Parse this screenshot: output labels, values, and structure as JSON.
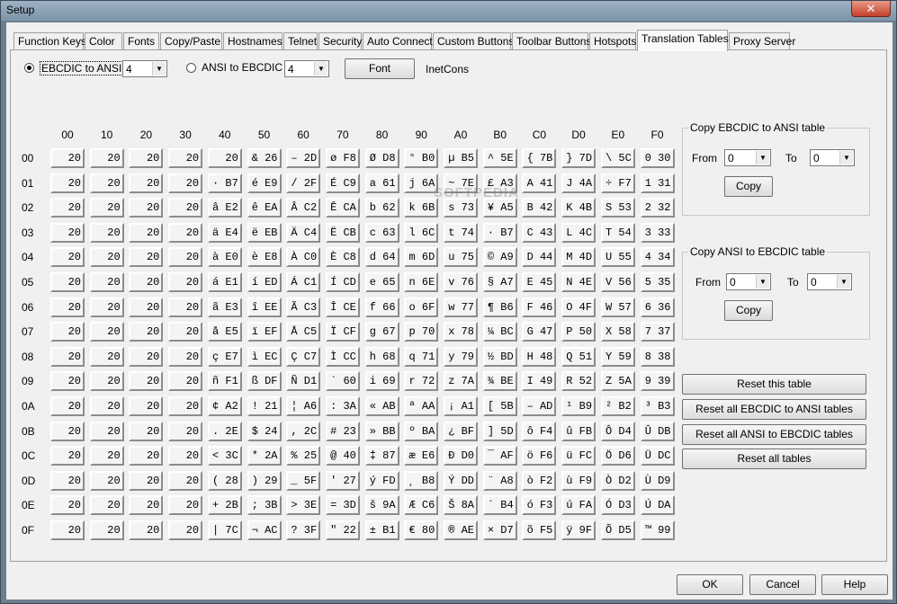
{
  "window": {
    "title": "Setup",
    "close_glyph": "✕"
  },
  "tabs": [
    "Function Keys",
    "Color",
    "Fonts",
    "Copy/Paste",
    "Hostnames",
    "Telnet",
    "Security",
    "Auto Connect",
    "Custom Buttons",
    "Toolbar Buttons",
    "Hotspots",
    "Translation Tables",
    "Proxy Server"
  ],
  "active_tab": "Translation Tables",
  "direction": {
    "ebcdic_label": "EBCDIC to ANSI",
    "ebcdic_value": "4",
    "ebcdic_selected": true,
    "ansi_label": "ANSI to EBCDIC",
    "ansi_value": "4",
    "font_button": "Font",
    "font_name": "InetCons"
  },
  "columns": [
    "00",
    "10",
    "20",
    "30",
    "40",
    "50",
    "60",
    "70",
    "80",
    "90",
    "A0",
    "B0",
    "C0",
    "D0",
    "E0",
    "F0"
  ],
  "rows": [
    "00",
    "01",
    "02",
    "03",
    "04",
    "05",
    "06",
    "07",
    "08",
    "09",
    "0A",
    "0B",
    "0C",
    "0D",
    "0E",
    "0F"
  ],
  "table": [
    [
      "20",
      "20",
      "20",
      "20",
      "20",
      "& 26",
      "– 2D",
      "ø F8",
      "Ø D8",
      "° B0",
      "µ B5",
      "^ 5E",
      "{ 7B",
      "} 7D",
      "\\ 5C",
      "0 30"
    ],
    [
      "20",
      "20",
      "20",
      "20",
      "· B7",
      "é E9",
      "/ 2F",
      "É C9",
      "a 61",
      "j 6A",
      "~ 7E",
      "£ A3",
      "A 41",
      "J 4A",
      "÷ F7",
      "1 31"
    ],
    [
      "20",
      "20",
      "20",
      "20",
      "â E2",
      "ê EA",
      "Â C2",
      "Ê CA",
      "b 62",
      "k 6B",
      "s 73",
      "¥ A5",
      "B 42",
      "K 4B",
      "S 53",
      "2 32"
    ],
    [
      "20",
      "20",
      "20",
      "20",
      "ä E4",
      "ë EB",
      "Ä C4",
      "Ë CB",
      "c 63",
      "l 6C",
      "t 74",
      "· B7",
      "C 43",
      "L 4C",
      "T 54",
      "3 33"
    ],
    [
      "20",
      "20",
      "20",
      "20",
      "à E0",
      "è E8",
      "À C0",
      "È C8",
      "d 64",
      "m 6D",
      "u 75",
      "© A9",
      "D 44",
      "M 4D",
      "U 55",
      "4 34"
    ],
    [
      "20",
      "20",
      "20",
      "20",
      "á E1",
      "í ED",
      "Á C1",
      "Í CD",
      "e 65",
      "n 6E",
      "v 76",
      "§ A7",
      "E 45",
      "N 4E",
      "V 56",
      "5 35"
    ],
    [
      "20",
      "20",
      "20",
      "20",
      "ã E3",
      "î EE",
      "Ã C3",
      "Î CE",
      "f 66",
      "o 6F",
      "w 77",
      "¶ B6",
      "F 46",
      "O 4F",
      "W 57",
      "6 36"
    ],
    [
      "20",
      "20",
      "20",
      "20",
      "å E5",
      "ï EF",
      "Å C5",
      "Ï CF",
      "g 67",
      "p 70",
      "x 78",
      "¼ BC",
      "G 47",
      "P 50",
      "X 58",
      "7 37"
    ],
    [
      "20",
      "20",
      "20",
      "20",
      "ç E7",
      "ì EC",
      "Ç C7",
      "Ì CC",
      "h 68",
      "q 71",
      "y 79",
      "½ BD",
      "H 48",
      "Q 51",
      "Y 59",
      "8 38"
    ],
    [
      "20",
      "20",
      "20",
      "20",
      "ñ F1",
      "ß DF",
      "Ñ D1",
      "` 60",
      "i 69",
      "r 72",
      "z 7A",
      "¾ BE",
      "I 49",
      "R 52",
      "Z 5A",
      "9 39"
    ],
    [
      "20",
      "20",
      "20",
      "20",
      "¢ A2",
      "! 21",
      "¦ A6",
      ": 3A",
      "« AB",
      "ª AA",
      "¡ A1",
      "[ 5B",
      "– AD",
      "¹ B9",
      "² B2",
      "³ B3"
    ],
    [
      "20",
      "20",
      "20",
      "20",
      ". 2E",
      "$ 24",
      ", 2C",
      "# 23",
      "» BB",
      "º BA",
      "¿ BF",
      "] 5D",
      "ô F4",
      "û FB",
      "Ô D4",
      "Û DB"
    ],
    [
      "20",
      "20",
      "20",
      "20",
      "< 3C",
      "* 2A",
      "% 25",
      "@ 40",
      "‡ 87",
      "æ E6",
      "Ð D0",
      "¯ AF",
      "ö F6",
      "ü FC",
      "Ö D6",
      "Ü DC"
    ],
    [
      "20",
      "20",
      "20",
      "20",
      "( 28",
      ") 29",
      "_ 5F",
      "' 27",
      "ý FD",
      "¸ B8",
      "Ý DD",
      "¨ A8",
      "ò F2",
      "ù F9",
      "Ò D2",
      "Ù D9"
    ],
    [
      "20",
      "20",
      "20",
      "20",
      "+ 2B",
      "; 3B",
      "> 3E",
      "= 3D",
      "š 9A",
      "Æ C6",
      "Š 8A",
      "´ B4",
      "ó F3",
      "ú FA",
      "Ó D3",
      "Ú DA"
    ],
    [
      "20",
      "20",
      "20",
      "20",
      "| 7C",
      "¬ AC",
      "? 3F",
      "\" 22",
      "± B1",
      "€ 80",
      "® AE",
      "× D7",
      "õ F5",
      "ÿ 9F",
      "Õ D5",
      "™ 99"
    ]
  ],
  "copy_e2a": {
    "title": "Copy EBCDIC to ANSI table",
    "from_label": "From",
    "from_value": "0",
    "to_label": "To",
    "to_value": "0",
    "button": "Copy"
  },
  "copy_a2e": {
    "title": "Copy ANSI to EBCDIC table",
    "from_label": "From",
    "from_value": "0",
    "to_label": "To",
    "to_value": "0",
    "button": "Copy"
  },
  "reset_buttons": [
    "Reset this table",
    "Reset all EBCDIC to ANSI tables",
    "Reset all ANSI to EBCDIC tables",
    "Reset all tables"
  ],
  "footer": {
    "ok": "OK",
    "cancel": "Cancel",
    "help": "Help"
  },
  "watermark": "SOFTPEDIA"
}
